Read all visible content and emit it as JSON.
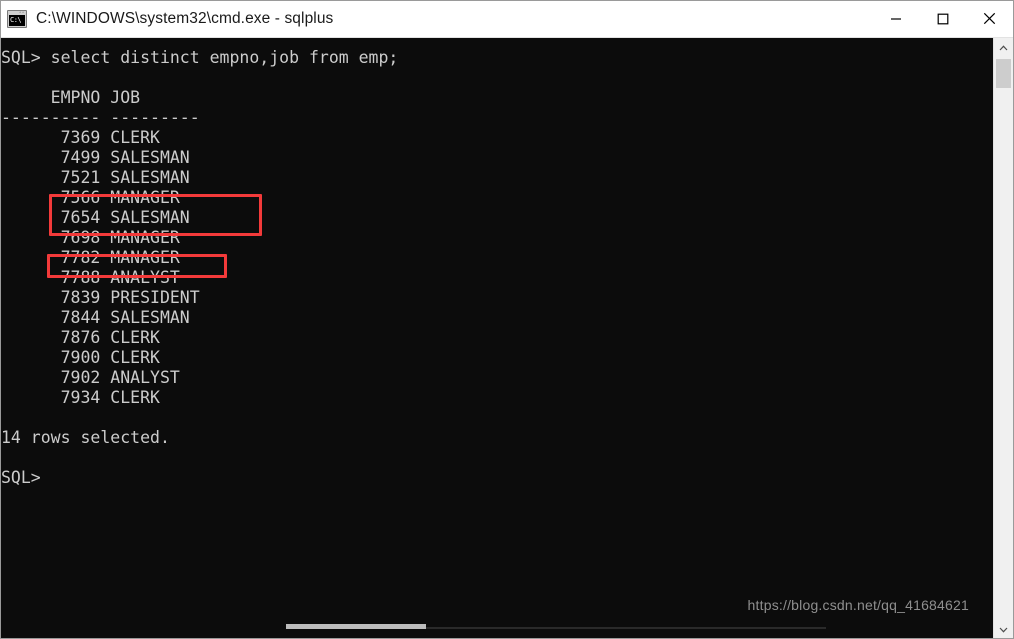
{
  "window": {
    "title": "C:\\WINDOWS\\system32\\cmd.exe - sqlplus",
    "icon": "cmd-console-icon",
    "icon_text": "C:\\",
    "controls": {
      "minimize": "minimize-button",
      "maximize": "maximize-button",
      "close": "close-button"
    }
  },
  "terminal": {
    "background_color": "#0c0c0c",
    "text_color": "#cccccc",
    "prompt": "SQL>",
    "lines": [
      "SQL> select distinct empno,job from emp;",
      "",
      "     EMPNO JOB",
      "---------- ---------",
      "      7369 CLERK",
      "      7499 SALESMAN",
      "      7521 SALESMAN",
      "      7566 MANAGER",
      "      7654 SALESMAN",
      "      7698 MANAGER",
      "      7782 MANAGER",
      "      7788 ANALYST",
      "      7839 PRESIDENT",
      "      7844 SALESMAN",
      "      7876 CLERK",
      "      7900 CLERK",
      "      7902 ANALYST",
      "      7934 CLERK",
      "",
      "14 rows selected.",
      "",
      "SQL>"
    ],
    "command": "select distinct empno,job from emp;",
    "columns": [
      "EMPNO",
      "JOB"
    ],
    "separator": "---------- ---------",
    "rows": [
      {
        "empno": "7369",
        "job": "CLERK"
      },
      {
        "empno": "7499",
        "job": "SALESMAN"
      },
      {
        "empno": "7521",
        "job": "SALESMAN"
      },
      {
        "empno": "7566",
        "job": "MANAGER"
      },
      {
        "empno": "7654",
        "job": "SALESMAN"
      },
      {
        "empno": "7698",
        "job": "MANAGER"
      },
      {
        "empno": "7782",
        "job": "MANAGER"
      },
      {
        "empno": "7788",
        "job": "ANALYST"
      },
      {
        "empno": "7839",
        "job": "PRESIDENT"
      },
      {
        "empno": "7844",
        "job": "SALESMAN"
      },
      {
        "empno": "7876",
        "job": "CLERK"
      },
      {
        "empno": "7900",
        "job": "CLERK"
      },
      {
        "empno": "7902",
        "job": "ANALYST"
      },
      {
        "empno": "7934",
        "job": "CLERK"
      }
    ],
    "result_status": "14 rows selected.",
    "row_count": 14
  },
  "annotations": {
    "color": "#f33a3a",
    "boxes": [
      {
        "label": "highlight-rows-7499-7521",
        "rows": [
          "7499 SALESMAN",
          "7521 SALESMAN"
        ]
      },
      {
        "label": "highlight-row-7654",
        "rows": [
          "7654 SALESMAN"
        ]
      }
    ]
  },
  "watermark": {
    "text": "https://blog.csdn.net/qq_41684621"
  },
  "scrollbars": {
    "vertical": {
      "up_arrow": "chevron-up-icon",
      "down_arrow": "chevron-down-icon"
    },
    "horizontal": {
      "present": true
    }
  }
}
